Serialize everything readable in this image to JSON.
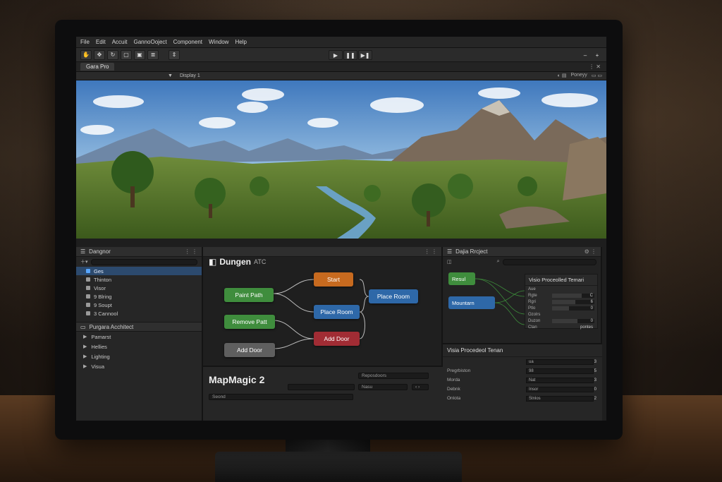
{
  "menu": [
    "File",
    "Edit",
    "Accuit",
    "GannoOoject",
    "Component",
    "Window",
    "Help"
  ],
  "toolbar": {
    "tools": [
      "hand-tool",
      "move-tool",
      "rotate-tool",
      "scale-tool",
      "rect-tool",
      "transform-tool",
      "custom-tool"
    ],
    "play": "▶",
    "pause": "❚❚",
    "step": "▶❚"
  },
  "game_view": {
    "tab_label": "Gara Pro",
    "display": "Display 1",
    "right_label": "Poneyy"
  },
  "hierarchy": {
    "title": "Dangnor",
    "items": [
      {
        "label": "Ges",
        "selected": true
      },
      {
        "label": "Thinton"
      },
      {
        "label": "Visor"
      },
      {
        "label": "9 Blring"
      },
      {
        "label": "9 Soupt"
      },
      {
        "label": "3 Cannool"
      }
    ],
    "section": "Purgara Acchitect",
    "folds": [
      "Pamarst",
      "Hellies",
      "Lighting",
      "Visua"
    ]
  },
  "node_editor": {
    "title": "Dungen",
    "title_suffix": "ATC",
    "nodes": {
      "start": "Start",
      "paint_path": "Paint Path",
      "place_room_center": "Place Room",
      "place_room_right": "Place Room",
      "remove_path": "Remove Patt",
      "add_door_gray": "Add Door",
      "add_door_red": "Add Door"
    }
  },
  "mapmagic": {
    "title": "MapMagic 2",
    "field_1": "Reposdoors",
    "field_2": "Nasu",
    "field_3": "Seond"
  },
  "right_panel": {
    "title": "Dajia Rrcject",
    "nodes": {
      "result": "Resul",
      "mountain": "Mountarn"
    },
    "prop_title": "Visio Proceolled Temari",
    "props": [
      {
        "label": "Aue",
        "value": ""
      },
      {
        "label": "Rgte",
        "value": "C"
      },
      {
        "label": "Rgri",
        "value": "6"
      },
      {
        "label": "Ptlo",
        "value": "0"
      },
      {
        "label": "Ozolrs",
        "value": ""
      },
      {
        "label": "Duzon",
        "value": "0"
      },
      {
        "label": "Ctan",
        "value": "pontes"
      }
    ]
  },
  "inspector": {
    "title": "Visia Procedeol Tenan",
    "rows": [
      {
        "label": "",
        "field": "ua",
        "value": "3"
      },
      {
        "label": "Pregrbiston",
        "field": "98",
        "value": "5"
      },
      {
        "label": "Morda",
        "field": "Nat",
        "value": "3"
      },
      {
        "label": "Debnk",
        "field": "Insor",
        "value": "0"
      },
      {
        "label": "Onlota",
        "field": "Stnlos",
        "value": "2"
      }
    ]
  }
}
